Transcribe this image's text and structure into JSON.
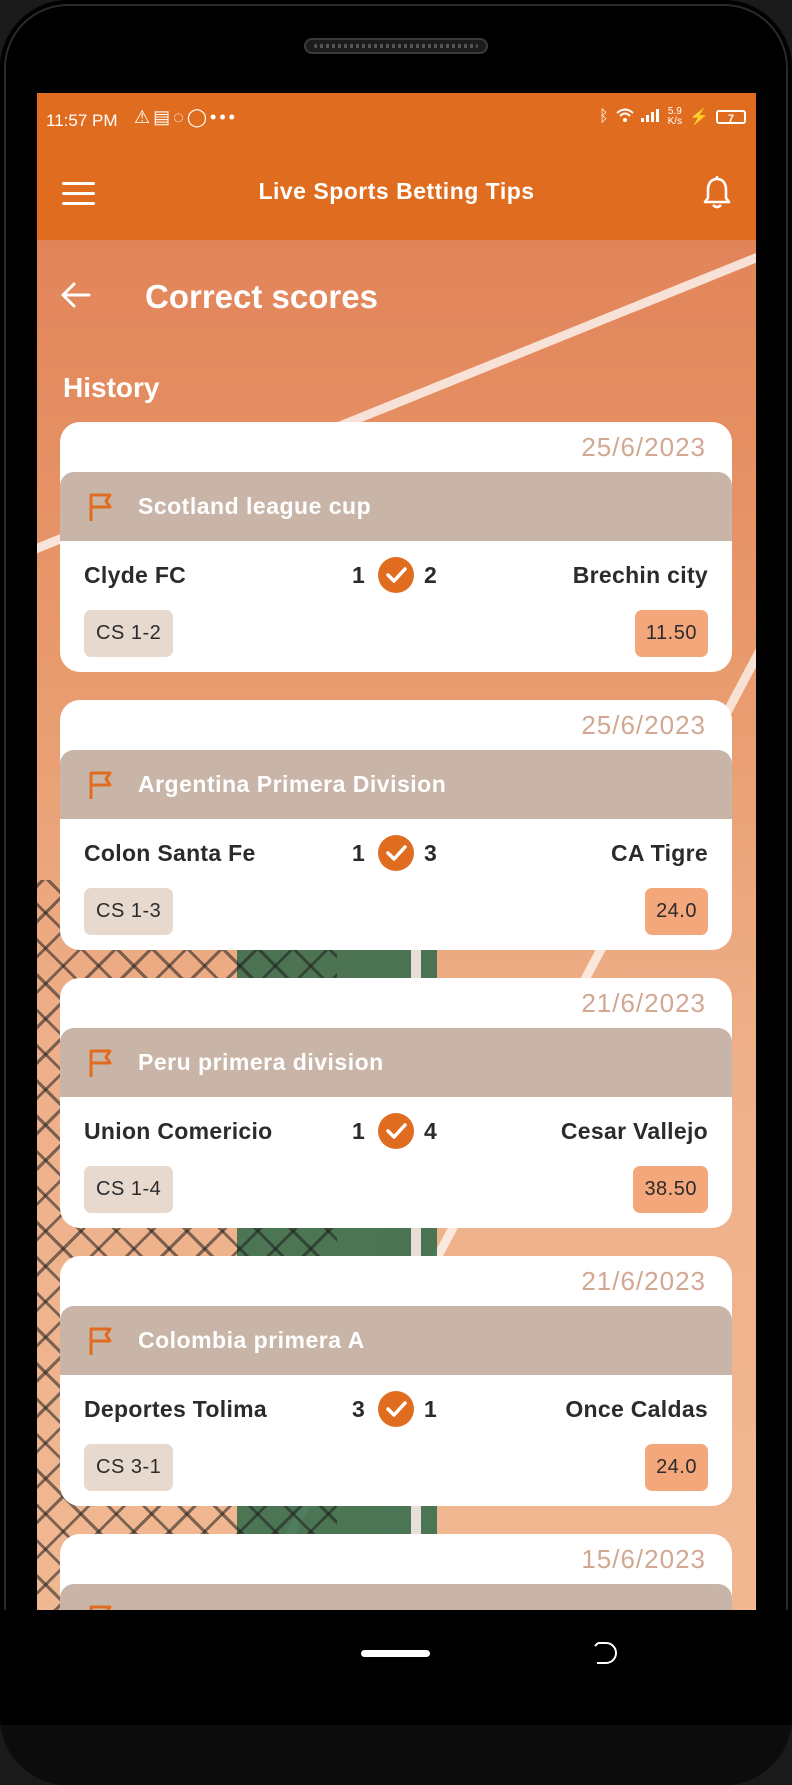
{
  "status_bar": {
    "time": "11:57 PM",
    "left_icons": [
      "warning-icon",
      "news-icon",
      "messenger-icon",
      "whatsapp-icon",
      "more-dots-icon"
    ],
    "right_icons": [
      "bluetooth-icon",
      "wifi-icon",
      "signal-icon",
      "charging-icon"
    ],
    "net_speed_value": "5.9",
    "net_speed_unit": "K/s",
    "battery": "7"
  },
  "app_bar": {
    "title": "Live Sports Betting Tips",
    "menu_icon": "hamburger-menu-icon",
    "notification_icon": "bell-icon"
  },
  "page": {
    "title": "Correct scores",
    "back_icon": "back-arrow-icon",
    "section": "History"
  },
  "colors": {
    "primary": "#e06d1f",
    "league_bar": "#c9b5a8",
    "date_text": "#d2a892",
    "odds_badge": "#f4a77a",
    "cs_badge": "#e8d9cf"
  },
  "matches": [
    {
      "date": "25/6/2023",
      "league": "Scotland league cup",
      "home": "Clyde FC",
      "home_score": "1",
      "away_score": "2",
      "away": "Brechin city",
      "prediction": "CS 1-2",
      "odds": "11.50",
      "result_icon": "check-circle-icon"
    },
    {
      "date": "25/6/2023",
      "league": "Argentina Primera Division",
      "home": "Colon Santa Fe",
      "home_score": "1",
      "away_score": "3",
      "away": "CA Tigre",
      "prediction": "CS 1-3",
      "odds": "24.0",
      "result_icon": "check-circle-icon"
    },
    {
      "date": "21/6/2023",
      "league": "Peru primera division",
      "home": "Union Comericio",
      "home_score": "1",
      "away_score": "4",
      "away": "Cesar Vallejo",
      "prediction": "CS 1-4",
      "odds": "38.50",
      "result_icon": "check-circle-icon"
    },
    {
      "date": "21/6/2023",
      "league": "Colombia primera A",
      "home": "Deportes Tolima",
      "home_score": "3",
      "away_score": "1",
      "away": "Once Caldas",
      "prediction": "CS 3-1",
      "odds": "24.0",
      "result_icon": "check-circle-icon"
    },
    {
      "date": "15/6/2023"
    }
  ],
  "nav": {
    "home_icon": "home-pill-icon",
    "back_icon": "back-gesture-icon"
  }
}
